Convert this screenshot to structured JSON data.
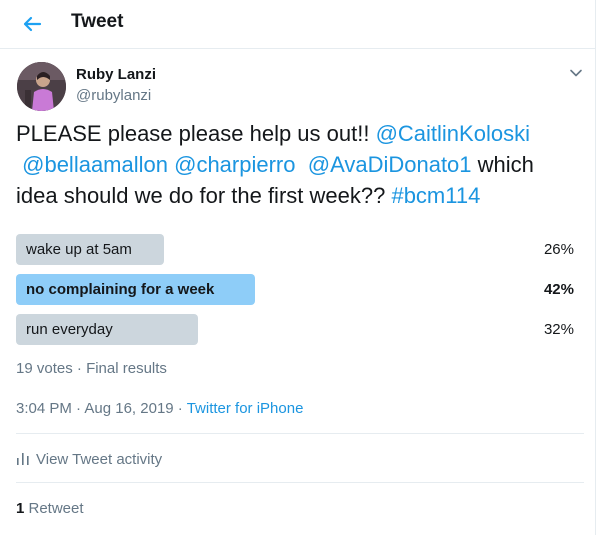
{
  "header": {
    "title": "Tweet",
    "back_icon": "arrow-left-icon"
  },
  "author": {
    "name": "Ruby Lanzi",
    "handle": "@rubylanzi"
  },
  "tweet": {
    "text_1": "PLEASE please please help us out!! ",
    "mention_1": "@CaitlinKoloski",
    "mention_2": "@bellaamallon",
    "mention_3": "@charpierro",
    "mention_4": "@AvaDiDonato1",
    "text_2": " which idea should we do for the first week?? ",
    "hashtag": "#bcm114"
  },
  "poll": {
    "options": [
      {
        "label": "wake up at 5am",
        "percent": "26%",
        "fraction": 0.26,
        "winner": false
      },
      {
        "label": "no complaining for a week",
        "percent": "42%",
        "fraction": 0.42,
        "winner": true
      },
      {
        "label": "run everyday",
        "percent": "32%",
        "fraction": 0.32,
        "winner": false
      }
    ],
    "votes": "19 votes",
    "separator": " · ",
    "status": "Final results"
  },
  "meta": {
    "time": "3:04 PM",
    "date": "Aug 16, 2019",
    "separator": " · ",
    "source": "Twitter for iPhone"
  },
  "activity": {
    "label": "View Tweet activity"
  },
  "stats": {
    "retweet_count": "1",
    "retweet_label": " Retweet"
  },
  "colors": {
    "link": "#1b95e0",
    "poll_bar": "#ccd6dd",
    "poll_winner": "#8ecdf8",
    "muted": "#657786"
  }
}
